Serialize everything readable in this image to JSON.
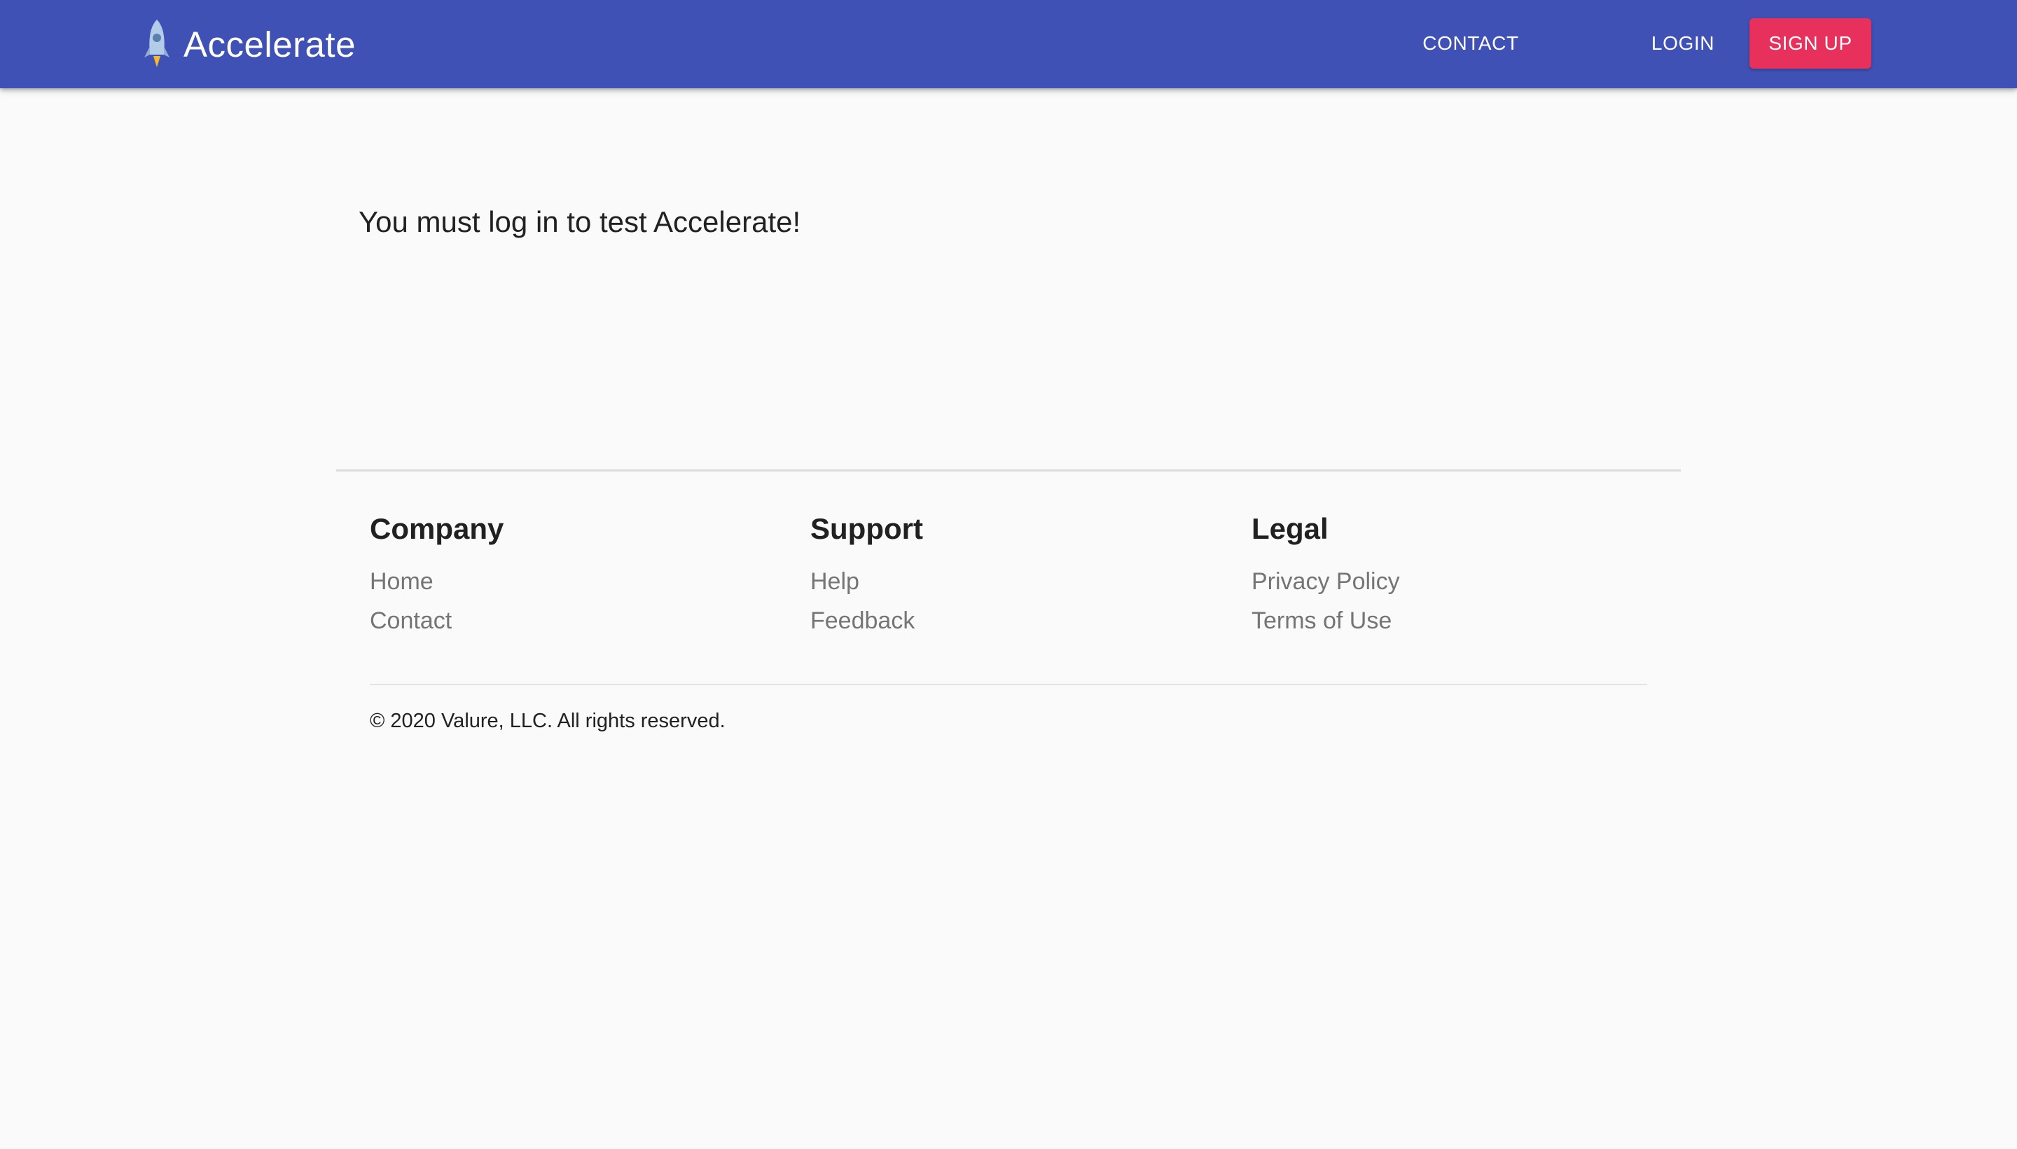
{
  "header": {
    "brand_name": "Accelerate",
    "brand_icon": "rocket-icon",
    "nav": {
      "contact_label": "CONTACT",
      "login_label": "LOGIN",
      "signup_label": "SIGN UP"
    }
  },
  "main": {
    "message": "You must log in to test Accelerate!"
  },
  "footer": {
    "columns": [
      {
        "heading": "Company",
        "links": [
          "Home",
          "Contact"
        ]
      },
      {
        "heading": "Support",
        "links": [
          "Help",
          "Feedback"
        ]
      },
      {
        "heading": "Legal",
        "links": [
          "Privacy Policy",
          "Terms of Use"
        ]
      }
    ],
    "copyright": "© 2020 Valure, LLC. All rights reserved."
  },
  "colors": {
    "app_bar": "#3f51b5",
    "signup_button": "#e8305d",
    "background": "#fafafa",
    "link_text": "#757575"
  }
}
